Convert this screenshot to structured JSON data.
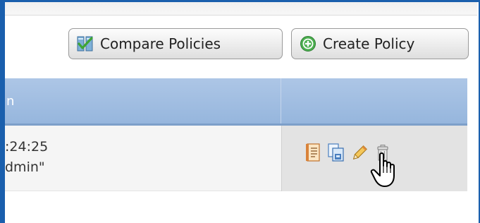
{
  "toolbar": {
    "compare_label": "Compare Policies",
    "create_label": "Create Policy"
  },
  "table": {
    "header_fragment": "n",
    "row": {
      "line1": ":24:25",
      "line2": "dmin\""
    },
    "actions": [
      {
        "name": "report-icon"
      },
      {
        "name": "copy-icon"
      },
      {
        "name": "edit-pencil-icon"
      },
      {
        "name": "delete-trash-icon"
      }
    ]
  },
  "colors": {
    "frame_border": "#1a5fad",
    "header_bg": "#a3c0e3",
    "action_cell_bg": "#e3e3e3",
    "create_icon_green": "#4caf50"
  }
}
